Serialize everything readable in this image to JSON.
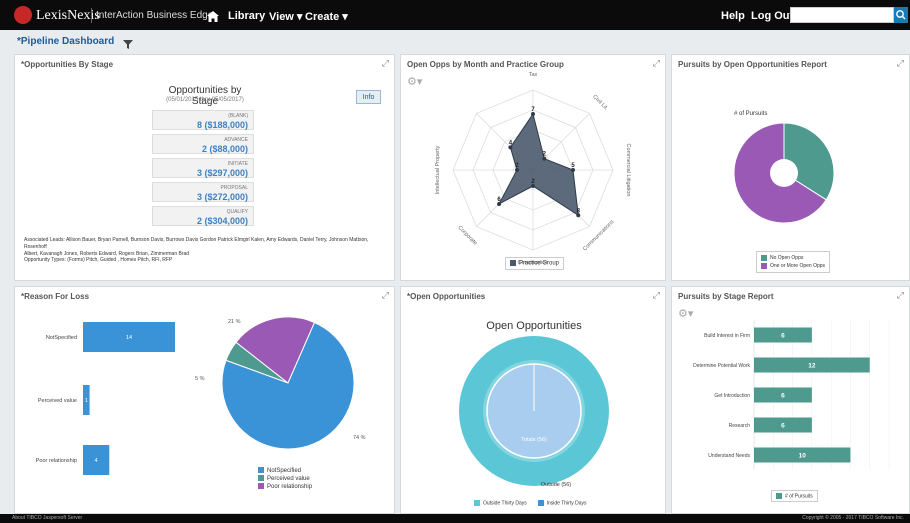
{
  "header": {
    "brand": "LexisNexis",
    "app_name": "InterAction Business Edge",
    "nav": [
      "Library",
      "View ▾",
      "Create ▾"
    ],
    "right_links": [
      "Help",
      "Log Out"
    ],
    "search_placeholder": ""
  },
  "page": {
    "title": "*Pipeline Dashboard"
  },
  "panels": {
    "stages": {
      "title": "*Opportunities By Stage",
      "chart_title": "Opportunities by Stage",
      "date_range": "(05/01/2015 thru 05/05/2017)",
      "info_label": "Info",
      "items": [
        {
          "name": "(BLANK)",
          "value": "8 ($188,000)"
        },
        {
          "name": "ADVANCE",
          "value": "2 ($88,000)"
        },
        {
          "name": "INITIATE",
          "value": "3 ($297,000)"
        },
        {
          "name": "PROPOSAL",
          "value": "3 ($272,000)"
        },
        {
          "name": "QUALIFY",
          "value": "2 ($304,000)"
        }
      ],
      "leads_line1": "Associated Leads: Allison Bauer, Bryan Parnell, Burnson Davis, Burrows Davis Gordon Patrick Elmgirl Kalen, Amy Edwards, Daniel Terry, Johnson Mattson, Rosenhoff",
      "leads_line2": "Albert, Kavanagh Jones, Roberts Edward, Rogers Brian, Zimmerman Brad",
      "types_line": "Opportunity Types: (Forms) Pitch, Guided , Homes Pitch, RFI, RFP"
    },
    "radar": {
      "title": "Open Opps by Month and Practice Group",
      "legend": "Practice Group"
    },
    "pursuits_pie": {
      "title": "Pursuits by Open Opportunities Report",
      "series_label": "# of Pursuits",
      "legend": [
        "No Open Opps",
        "One or More Open Opps"
      ]
    },
    "loss": {
      "title": "*Reason For Loss",
      "pie_labels": [
        "21 %",
        "5 %",
        "74 %"
      ],
      "legend": [
        "NotSpecified",
        "Perceived value",
        "Poor relationship"
      ]
    },
    "open_opps": {
      "title": "*Open Opportunities",
      "chart_title": "Open Opportunities",
      "inner_label": "Totals (56)",
      "outer_label": "Outside (56)",
      "legend": [
        "Outside Thirty Days",
        "Inside Thirty Days"
      ]
    },
    "pursuits_stage": {
      "title": "Pursuits by Stage Report",
      "legend": "# of Pursuits"
    }
  },
  "colors": {
    "teal": "#4e9a8e",
    "purple": "#9b59b6",
    "blue": "#3a93d6",
    "slate": "#4a5a6e",
    "light_cyan": "#5bc7d6",
    "pale_blue": "#a8cdef",
    "link_blue": "#1e5a96"
  },
  "chart_data": [
    {
      "type": "radar",
      "categories": [
        "Tax",
        "Civil Lit.",
        "Commercial Litigation",
        "Communications",
        "Construction",
        "Corporate",
        "Intellectual Property",
        ""
      ],
      "series": [
        {
          "name": "Practice Group",
          "values": [
            7,
            2,
            5,
            8,
            2,
            6,
            2,
            4
          ]
        }
      ]
    },
    {
      "type": "pie",
      "categories": [
        "No Open Opps",
        "One or More Open Opps"
      ],
      "values": [
        34,
        66
      ]
    },
    {
      "type": "bar",
      "orientation": "horizontal",
      "categories": [
        "NotSpecified",
        "Perceived value",
        "Poor relationship"
      ],
      "values": [
        14,
        1,
        4
      ]
    },
    {
      "type": "pie",
      "categories": [
        "NotSpecified",
        "Perceived value",
        "Poor relationship"
      ],
      "values": [
        74,
        5,
        21
      ]
    },
    {
      "type": "pie",
      "categories": [
        "Outside Thirty Days",
        "Inside Thirty Days"
      ],
      "values": [
        56,
        56
      ]
    },
    {
      "type": "bar",
      "orientation": "horizontal",
      "categories": [
        "Build Interest in Firm",
        "Determine Potential Work",
        "Get Introduction",
        "Research",
        "Understand Needs"
      ],
      "values": [
        6,
        12,
        6,
        6,
        10
      ],
      "xlim": [
        0,
        14
      ]
    }
  ],
  "footer": {
    "left": "About TIBCO Jaspersoft Server",
    "right": "Copyright © 2005 - 2017 TIBCO Software Inc."
  }
}
